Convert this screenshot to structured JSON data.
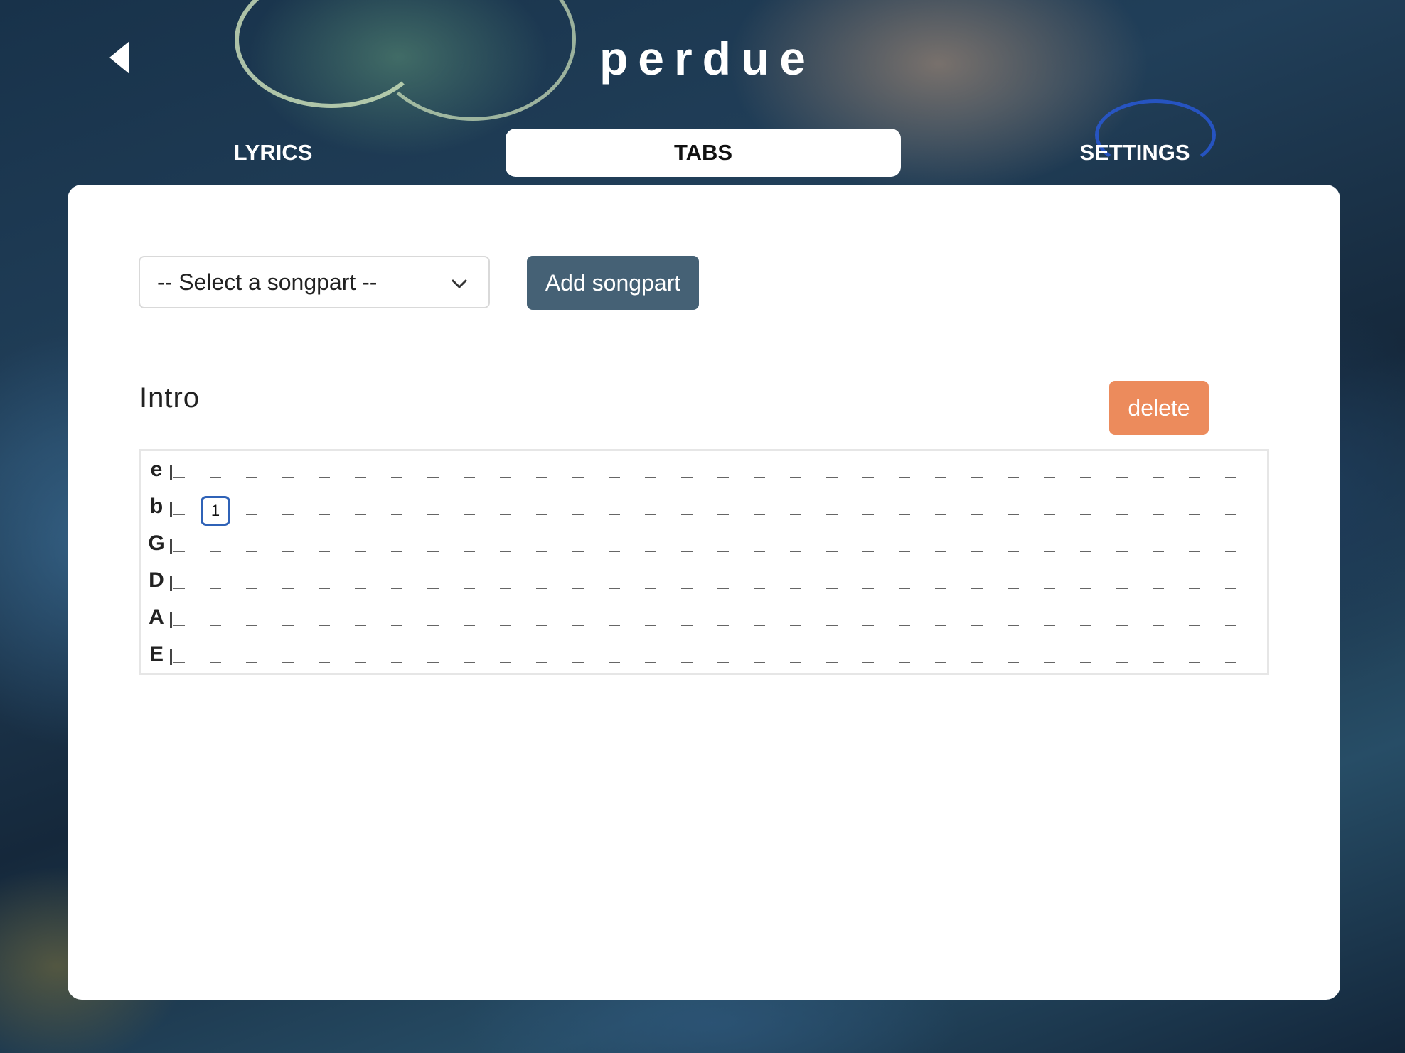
{
  "header": {
    "title": "perdue",
    "back_icon": "chevron-left-icon"
  },
  "tabs": [
    {
      "label": "LYRICS",
      "active": false
    },
    {
      "label": "TABS",
      "active": true
    },
    {
      "label": "SETTINGS",
      "active": false
    }
  ],
  "toolbar": {
    "select_value": "-- Select a songpart --",
    "add_label": "Add songpart"
  },
  "songpart": {
    "title": "Intro",
    "delete_label": "delete",
    "columns": 30,
    "strings": [
      {
        "name": "e",
        "notes": {}
      },
      {
        "name": "b",
        "notes": {
          "1": "1"
        }
      },
      {
        "name": "G",
        "notes": {}
      },
      {
        "name": "D",
        "notes": {}
      },
      {
        "name": "A",
        "notes": {}
      },
      {
        "name": "E",
        "notes": {}
      }
    ]
  },
  "colors": {
    "accent": "#456175",
    "danger": "#ec8b5c",
    "selected_border": "#2f62b7"
  }
}
